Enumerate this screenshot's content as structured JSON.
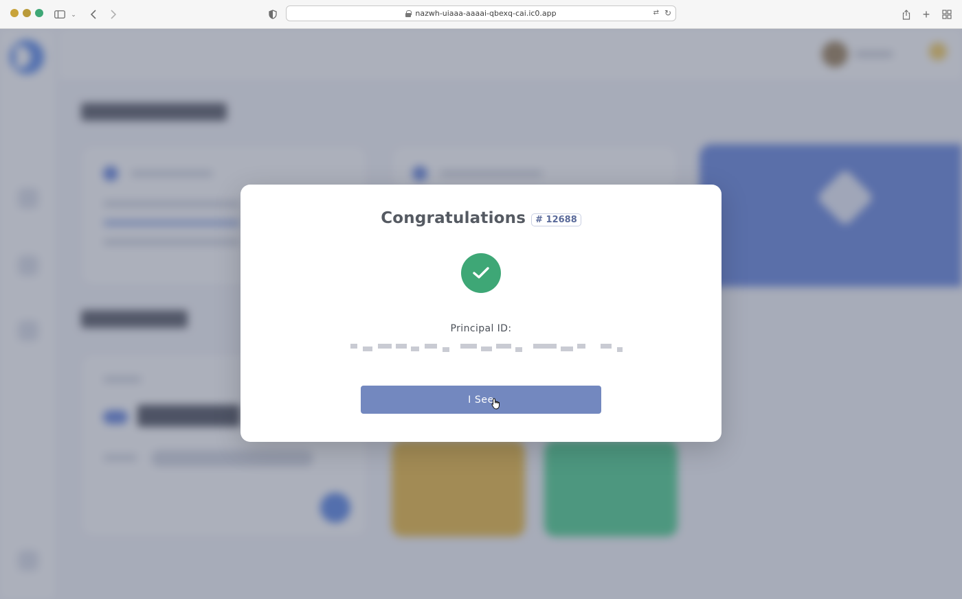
{
  "browser": {
    "url": "nazwh-uiaaa-aaaai-qbexq-cai.ic0.app",
    "traffic_colors": [
      "#c8a33a",
      "#b99a3a",
      "#3ea776"
    ]
  },
  "modal": {
    "title": "Congratulations",
    "badge": "# 12688",
    "status_icon": "check-icon",
    "principal_label": "Principal ID:",
    "principal_value_redacted": true,
    "button_label": "I See"
  },
  "colors": {
    "accent_button": "#7388bf",
    "success": "#3ea776"
  }
}
